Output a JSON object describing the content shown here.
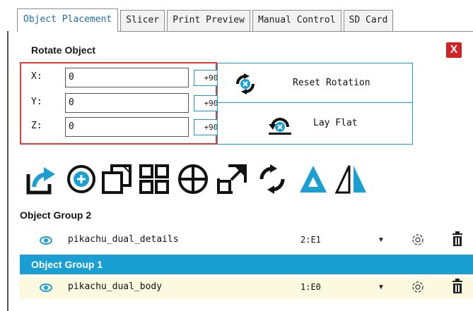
{
  "tabs": [
    "Object Placement",
    "Slicer",
    "Print Preview",
    "Manual Control",
    "SD Card"
  ],
  "rotate": {
    "title": "Rotate Object",
    "close_label": "X",
    "axes": [
      {
        "label": "X:",
        "value": "0",
        "button": "+90"
      },
      {
        "label": "Y:",
        "value": "0",
        "button": "+90"
      },
      {
        "label": "Z:",
        "value": "0",
        "button": "+90"
      }
    ],
    "reset_label": "Reset Rotation",
    "lay_flat_label": "Lay Flat"
  },
  "toolbar": [
    "export-icon",
    "add-icon",
    "copy-icon",
    "arrange-icon",
    "center-icon",
    "scale-icon",
    "rotate-icon",
    "mirror-icon",
    "split-icon"
  ],
  "groups": [
    {
      "name": "Object Group 2",
      "objects": [
        {
          "name": "pikachu_dual_details",
          "extruder": "2:E1"
        }
      ]
    },
    {
      "name": "Object Group 1",
      "objects": [
        {
          "name": "pikachu_dual_body",
          "extruder": "1:E0"
        }
      ]
    }
  ],
  "colors": {
    "accent": "#1a9fd2",
    "highlight_border": "#e53935",
    "close": "#d42126",
    "selected_row": "#fbf9e0"
  }
}
